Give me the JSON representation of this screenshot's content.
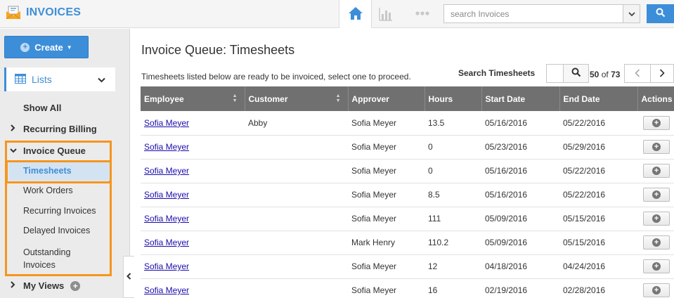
{
  "app": {
    "title": "INVOICES",
    "search_placeholder": "search Invoices"
  },
  "sidebar": {
    "create_label": "Create",
    "lists_label": "Lists",
    "show_all": "Show All",
    "recurring_billing": "Recurring Billing",
    "invoice_queue": "Invoice Queue",
    "queue_items": [
      "Timesheets",
      "Work Orders",
      "Recurring Invoices",
      "Delayed Invoices",
      "Outstanding Invoices"
    ],
    "my_views": "My Views"
  },
  "main": {
    "title": "Invoice Queue: Timesheets",
    "description": "Timesheets listed below are ready to be invoiced, select one to proceed.",
    "search_label": "Search Timesheets",
    "pager": {
      "range": "50",
      "of_word": "of",
      "total": "73"
    },
    "columns": [
      "Employee",
      "Customer",
      "Approver",
      "Hours",
      "Start Date",
      "End Date",
      "Actions"
    ],
    "rows": [
      [
        "Sofia Meyer",
        "Abby",
        "Sofia Meyer",
        "13.5",
        "05/16/2016",
        "05/22/2016"
      ],
      [
        "Sofia Meyer",
        "",
        "Sofia Meyer",
        "0",
        "05/23/2016",
        "05/29/2016"
      ],
      [
        "Sofia Meyer",
        "",
        "Sofia Meyer",
        "0",
        "05/16/2016",
        "05/22/2016"
      ],
      [
        "Sofia Meyer",
        "",
        "Sofia Meyer",
        "8.5",
        "05/16/2016",
        "05/22/2016"
      ],
      [
        "Sofia Meyer",
        "",
        "Sofia Meyer",
        "111",
        "05/09/2016",
        "05/15/2016"
      ],
      [
        "Sofia Meyer",
        "",
        "Mark Henry",
        "110.2",
        "05/09/2016",
        "05/15/2016"
      ],
      [
        "Sofia Meyer",
        "",
        "Sofia Meyer",
        "12",
        "04/18/2016",
        "04/24/2016"
      ],
      [
        "Sofia Meyer",
        "",
        "Sofia Meyer",
        "16",
        "02/19/2016",
        "02/28/2016"
      ]
    ]
  },
  "colors": {
    "accent": "#3d8ed8",
    "highlight": "#f5961e",
    "header_bg": "#707070"
  },
  "icons": {
    "brand": "invoice-envelope-icon",
    "home": "home-icon",
    "chart": "bar-chart-icon",
    "more": "more-dots-icon",
    "search": "search-icon"
  }
}
